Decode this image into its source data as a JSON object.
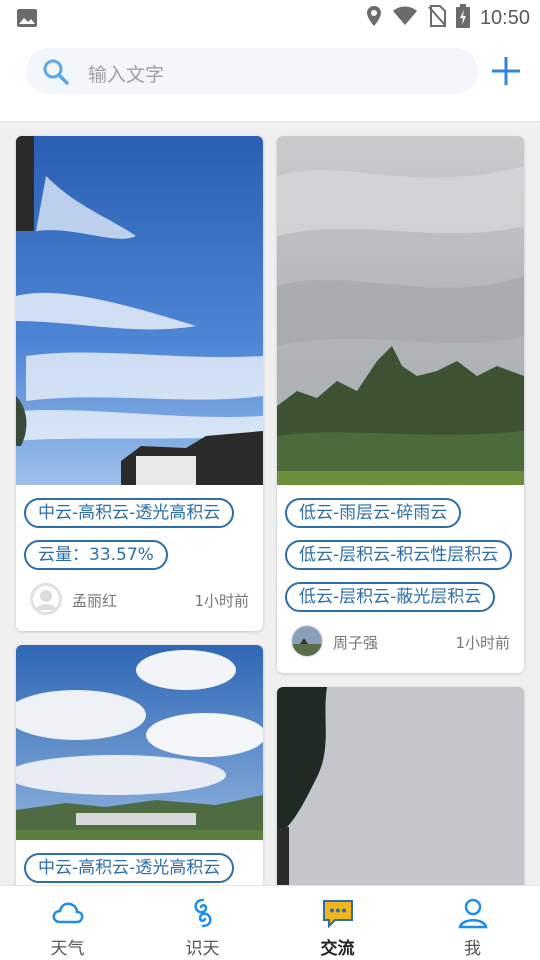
{
  "status_bar": {
    "time": "10:50"
  },
  "search": {
    "placeholder": "输入文字"
  },
  "feed": {
    "cards": [
      {
        "tags": [
          "中云-高积云-透光高积云",
          "云量：33.57%"
        ],
        "author": "孟丽红",
        "time": "1小时前"
      },
      {
        "tags": [
          "低云-雨层云-碎雨云",
          "低云-层积云-积云性层积云",
          "低云-层积云-蔽光层积云"
        ],
        "author": "周子强",
        "time": "1小时前"
      },
      {
        "tags": [
          "中云-高积云-透光高积云"
        ]
      },
      {
        "tags": []
      }
    ]
  },
  "nav": {
    "items": [
      {
        "label": "天气",
        "icon": "cloud-icon"
      },
      {
        "label": "识天",
        "icon": "swirl-icon"
      },
      {
        "label": "交流",
        "icon": "chat-icon",
        "active": true
      },
      {
        "label": "我",
        "icon": "person-icon"
      }
    ]
  },
  "colors": {
    "accent": "#2d6eaa",
    "nav_icon": "#1f8ee6",
    "chat_icon": "#f2b51b"
  }
}
